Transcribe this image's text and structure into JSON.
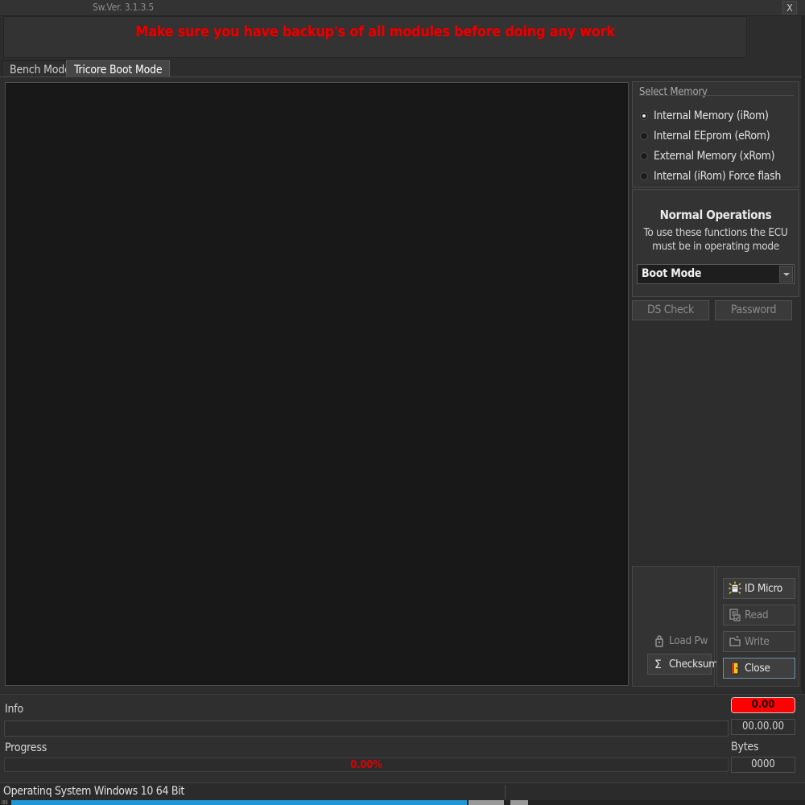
{
  "window": {
    "version_label": "Sw.Ver. 3.1.3.5",
    "close_button": "X"
  },
  "banner": {
    "warning": "Make sure you have backup's of all modules before doing any work",
    "color": "#e60000"
  },
  "tabs": [
    {
      "label": "Bench Mode",
      "active": false
    },
    {
      "label": "Tricore Boot Mode",
      "active": true
    }
  ],
  "select_memory": {
    "caption": "Select Memory",
    "options": [
      {
        "label": "Internal Memory (iRom)",
        "selected": true
      },
      {
        "label": "Internal EEprom (eRom)",
        "selected": false
      },
      {
        "label": "External Memory (xRom)",
        "selected": false
      },
      {
        "label": "Internal (iRom) Force flash",
        "selected": false
      }
    ]
  },
  "normal_operations": {
    "title": "Normal Operations",
    "note": "To use these functions the ECU must be in operating mode",
    "mode_select": {
      "value": "Boot Mode",
      "options": [
        "Boot Mode"
      ]
    },
    "ds_check_label": "DS Check",
    "password_label": "Password"
  },
  "actions": {
    "left": [
      {
        "label": "Load Pw",
        "icon": "key-lock-icon",
        "enabled": false
      },
      {
        "label": "Checksum",
        "icon": "sigma-icon",
        "enabled": true
      }
    ],
    "right": [
      {
        "label": "ID Micro",
        "icon": "chip-flash-icon",
        "enabled": true
      },
      {
        "label": "Read",
        "icon": "read-document-icon",
        "enabled": false
      },
      {
        "label": "Write",
        "icon": "write-folder-icon",
        "enabled": false
      },
      {
        "label": "Close",
        "icon": "exit-door-icon",
        "enabled": true
      }
    ]
  },
  "footer": {
    "info_label": "Info",
    "info_value": "",
    "progress_label": "Progress",
    "progress_percent": "0.00%",
    "progress_value": 0,
    "timer_primary": "0.00",
    "timer_secondary": "00.00.00",
    "bytes_label": "Bytes",
    "bytes_value": "0000"
  },
  "status_bar": {
    "text": "Operatinq System Windows 10 64 Bit"
  },
  "log": {
    "content": ""
  }
}
